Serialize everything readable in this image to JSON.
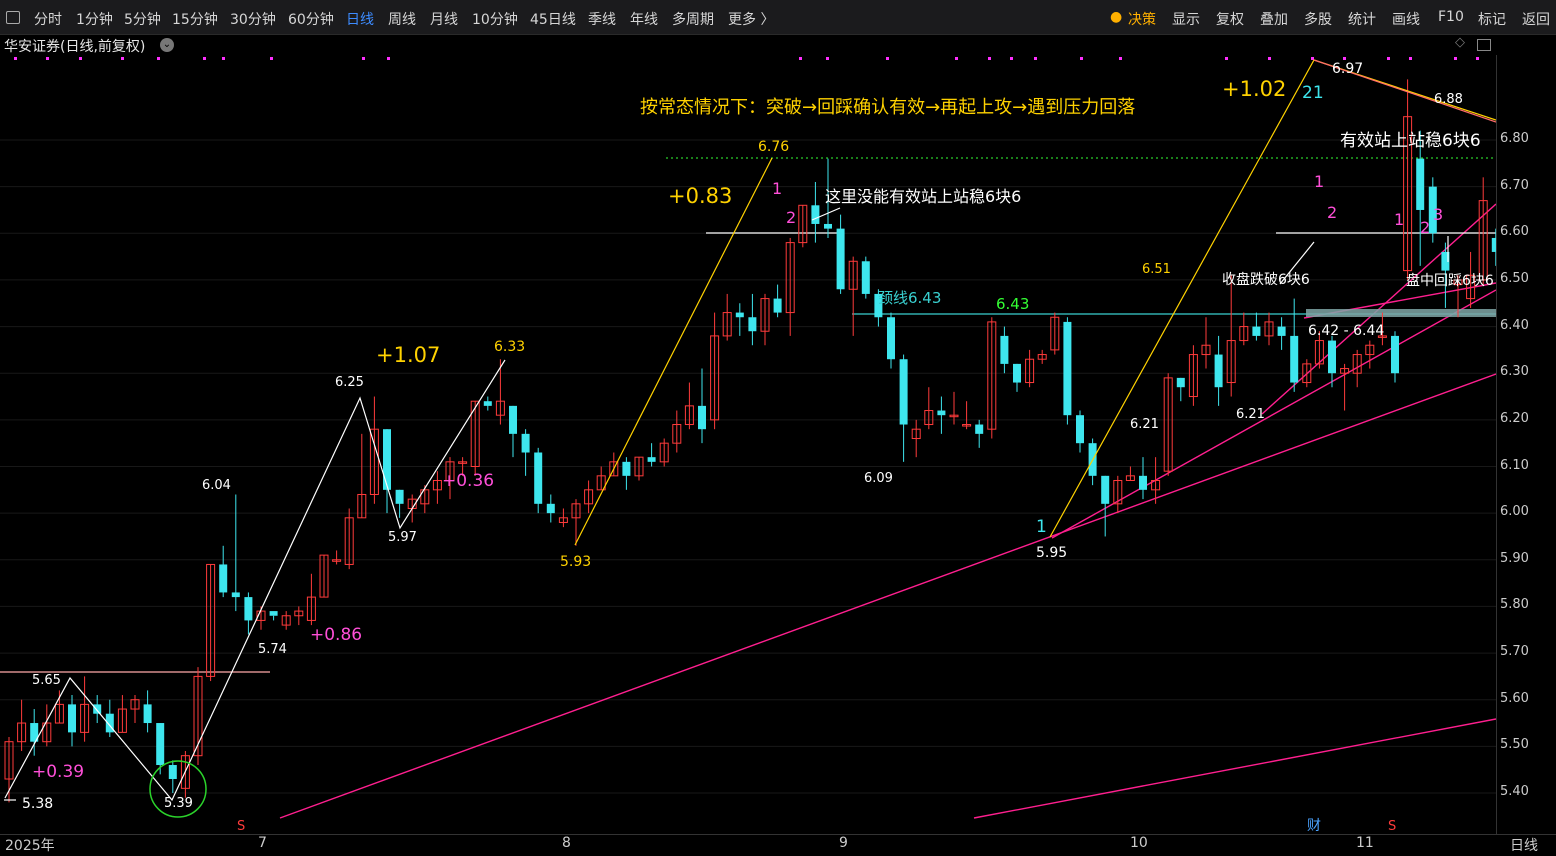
{
  "toolbar": {
    "periods": [
      "分时",
      "1分钟",
      "5分钟",
      "15分钟",
      "30分钟",
      "60分钟",
      "日线",
      "周线",
      "月线",
      "10分钟",
      "45日线",
      "季线",
      "年线",
      "多周期",
      "更多 〉"
    ],
    "active_period": "日线",
    "right": [
      "决策",
      "显示",
      "复权",
      "叠加",
      "多股",
      "统计",
      "画线",
      "F10",
      "标记",
      "返回"
    ]
  },
  "title": "华安证券(日线,前复权)",
  "period_label": "日线",
  "colors": {
    "up": "#ff3b3b",
    "down": "#3ee6ee",
    "annot_white": "#ffffff",
    "annot_yellow": "#ffd200",
    "annot_magenta": "#ff4fd8",
    "trend": "#ff1f8f",
    "neck": "#39d0d0"
  },
  "chart_data": {
    "type": "candlestick",
    "ylim": [
      5.35,
      6.95
    ],
    "y_ticks": [
      "5.40",
      "5.50",
      "5.60",
      "5.70",
      "5.80",
      "5.90",
      "6.00",
      "6.10",
      "6.20",
      "6.30",
      "6.40",
      "6.50",
      "6.60",
      "6.70",
      "6.80"
    ],
    "x_ticks": [
      "2025年",
      "7",
      "8",
      "9",
      "10",
      "11"
    ],
    "candles": [
      [
        5.43,
        5.51,
        5.38,
        5.52
      ],
      [
        5.51,
        5.55,
        5.49,
        5.6
      ],
      [
        5.55,
        5.51,
        5.48,
        5.58
      ],
      [
        5.51,
        5.55,
        5.5,
        5.59
      ],
      [
        5.55,
        5.59,
        5.55,
        5.62
      ],
      [
        5.59,
        5.53,
        5.5,
        5.61
      ],
      [
        5.53,
        5.59,
        5.51,
        5.65
      ],
      [
        5.59,
        5.57,
        5.55,
        5.61
      ],
      [
        5.57,
        5.53,
        5.52,
        5.6
      ],
      [
        5.53,
        5.58,
        5.53,
        5.61
      ],
      [
        5.58,
        5.6,
        5.55,
        5.61
      ],
      [
        5.59,
        5.55,
        5.53,
        5.62
      ],
      [
        5.55,
        5.46,
        5.44,
        5.55
      ],
      [
        5.46,
        5.43,
        5.4,
        5.47
      ],
      [
        5.41,
        5.48,
        5.39,
        5.49
      ],
      [
        5.48,
        5.65,
        5.46,
        5.67
      ],
      [
        5.65,
        5.89,
        5.64,
        5.89
      ],
      [
        5.89,
        5.83,
        5.82,
        5.93
      ],
      [
        5.83,
        5.82,
        5.79,
        6.04
      ],
      [
        5.82,
        5.77,
        5.74,
        5.83
      ],
      [
        5.77,
        5.79,
        5.75,
        5.8
      ],
      [
        5.79,
        5.78,
        5.77,
        5.78
      ],
      [
        5.76,
        5.78,
        5.75,
        5.79
      ],
      [
        5.78,
        5.79,
        5.76,
        5.8
      ],
      [
        5.77,
        5.82,
        5.76,
        5.87
      ],
      [
        5.82,
        5.91,
        5.82,
        5.91
      ],
      [
        5.9,
        5.9,
        5.89,
        5.92
      ],
      [
        5.89,
        5.99,
        5.88,
        6.01
      ],
      [
        5.99,
        6.04,
        5.99,
        6.17
      ],
      [
        6.04,
        6.18,
        6.02,
        6.25
      ],
      [
        6.18,
        6.05,
        6.0,
        6.18
      ],
      [
        6.05,
        6.02,
        5.99,
        6.05
      ],
      [
        6.01,
        6.03,
        5.98,
        6.04
      ],
      [
        6.02,
        6.05,
        6.0,
        6.06
      ],
      [
        6.05,
        6.07,
        6.02,
        6.09
      ],
      [
        6.07,
        6.11,
        6.03,
        6.12
      ],
      [
        6.11,
        6.11,
        6.08,
        6.12
      ],
      [
        6.1,
        6.24,
        6.08,
        6.24
      ],
      [
        6.24,
        6.23,
        6.22,
        6.25
      ],
      [
        6.21,
        6.24,
        6.19,
        6.33
      ],
      [
        6.23,
        6.17,
        6.12,
        6.23
      ],
      [
        6.17,
        6.13,
        6.08,
        6.18
      ],
      [
        6.13,
        6.02,
        6.0,
        6.14
      ],
      [
        6.02,
        6.0,
        5.98,
        6.04
      ],
      [
        5.98,
        5.99,
        5.97,
        6.01
      ],
      [
        5.99,
        6.02,
        5.93,
        6.03
      ],
      [
        6.02,
        6.05,
        6.0,
        6.07
      ],
      [
        6.05,
        6.08,
        6.05,
        6.1
      ],
      [
        6.08,
        6.11,
        6.08,
        6.13
      ],
      [
        6.11,
        6.08,
        6.05,
        6.12
      ],
      [
        6.08,
        6.12,
        6.07,
        6.12
      ],
      [
        6.12,
        6.11,
        6.1,
        6.15
      ],
      [
        6.11,
        6.15,
        6.1,
        6.16
      ],
      [
        6.15,
        6.19,
        6.13,
        6.22
      ],
      [
        6.19,
        6.23,
        6.18,
        6.28
      ],
      [
        6.23,
        6.18,
        6.15,
        6.31
      ],
      [
        6.2,
        6.38,
        6.18,
        6.43
      ],
      [
        6.38,
        6.43,
        6.37,
        6.47
      ],
      [
        6.43,
        6.42,
        6.38,
        6.45
      ],
      [
        6.42,
        6.39,
        6.36,
        6.47
      ],
      [
        6.39,
        6.46,
        6.36,
        6.47
      ],
      [
        6.46,
        6.43,
        6.42,
        6.49
      ],
      [
        6.43,
        6.58,
        6.38,
        6.59
      ],
      [
        6.58,
        6.66,
        6.57,
        6.66
      ],
      [
        6.66,
        6.62,
        6.58,
        6.71
      ],
      [
        6.62,
        6.61,
        6.59,
        6.76
      ],
      [
        6.61,
        6.48,
        6.47,
        6.64
      ],
      [
        6.48,
        6.54,
        6.38,
        6.55
      ],
      [
        6.54,
        6.47,
        6.46,
        6.55
      ],
      [
        6.47,
        6.42,
        6.4,
        6.48
      ],
      [
        6.42,
        6.33,
        6.31,
        6.43
      ],
      [
        6.33,
        6.19,
        6.11,
        6.34
      ],
      [
        6.16,
        6.18,
        6.12,
        6.2
      ],
      [
        6.19,
        6.22,
        6.18,
        6.27
      ],
      [
        6.22,
        6.21,
        6.17,
        6.25
      ],
      [
        6.21,
        6.21,
        6.19,
        6.26
      ],
      [
        6.19,
        6.19,
        6.18,
        6.24
      ],
      [
        6.19,
        6.17,
        6.14,
        6.2
      ],
      [
        6.18,
        6.41,
        6.16,
        6.42
      ],
      [
        6.38,
        6.32,
        6.3,
        6.4
      ],
      [
        6.32,
        6.28,
        6.26,
        6.32
      ],
      [
        6.28,
        6.33,
        6.27,
        6.35
      ],
      [
        6.33,
        6.34,
        6.32,
        6.35
      ],
      [
        6.35,
        6.42,
        6.34,
        6.43
      ],
      [
        6.41,
        6.21,
        6.19,
        6.42
      ],
      [
        6.21,
        6.15,
        6.13,
        6.22
      ],
      [
        6.15,
        6.08,
        6.06,
        6.16
      ],
      [
        6.08,
        6.02,
        5.95,
        6.08
      ],
      [
        6.02,
        6.07,
        6.0,
        6.08
      ],
      [
        6.07,
        6.08,
        6.07,
        6.1
      ],
      [
        6.08,
        6.05,
        6.03,
        6.12
      ],
      [
        6.05,
        6.07,
        6.02,
        6.12
      ],
      [
        6.09,
        6.29,
        6.08,
        6.3
      ],
      [
        6.29,
        6.27,
        6.24,
        6.29
      ],
      [
        6.25,
        6.34,
        6.23,
        6.36
      ],
      [
        6.34,
        6.36,
        6.31,
        6.42
      ],
      [
        6.34,
        6.27,
        6.23,
        6.38
      ],
      [
        6.28,
        6.37,
        6.25,
        6.51
      ],
      [
        6.37,
        6.4,
        6.36,
        6.43
      ],
      [
        6.4,
        6.38,
        6.37,
        6.43
      ],
      [
        6.38,
        6.41,
        6.36,
        6.43
      ],
      [
        6.4,
        6.38,
        6.35,
        6.42
      ],
      [
        6.38,
        6.28,
        6.26,
        6.46
      ],
      [
        6.28,
        6.32,
        6.27,
        6.33
      ],
      [
        6.32,
        6.37,
        6.31,
        6.39
      ],
      [
        6.37,
        6.3,
        6.27,
        6.38
      ],
      [
        6.3,
        6.31,
        6.22,
        6.32
      ],
      [
        6.3,
        6.34,
        6.27,
        6.35
      ],
      [
        6.34,
        6.36,
        6.31,
        6.37
      ],
      [
        6.38,
        6.38,
        6.36,
        6.43
      ],
      [
        6.38,
        6.3,
        6.28,
        6.39
      ],
      [
        6.52,
        6.85,
        6.5,
        6.93
      ],
      [
        6.76,
        6.65,
        6.53,
        6.82
      ],
      [
        6.7,
        6.6,
        6.58,
        6.72
      ],
      [
        6.56,
        6.52,
        6.44,
        6.58
      ],
      [
        6.49,
        6.5,
        6.42,
        6.51
      ],
      [
        6.46,
        6.51,
        6.44,
        6.56
      ],
      [
        6.5,
        6.67,
        6.49,
        6.72
      ],
      [
        6.59,
        6.56,
        6.53,
        6.61
      ],
      [
        6.55,
        6.69,
        6.53,
        6.76
      ],
      [
        6.67,
        6.71,
        6.6,
        6.88
      ],
      [
        6.69,
        6.67,
        6.64,
        6.74
      ]
    ]
  },
  "annotations": {
    "main_note": "按常态情况下：突破→回踩确认有效→再起上攻→遇到压力回落",
    "fail_note": "这里没能有效站上站稳6块6",
    "hold_note": "有效站上站稳6块6",
    "break_note": "收盘跌破6块6",
    "intraday_note": "盘中回踩6块6",
    "neck_label": "颈线6.43",
    "zone_label": "6.42 - 6.44",
    "neck_price": "6.43",
    "gains": [
      "+0.39",
      "+0.86",
      "+1.07",
      "+0.36",
      "+0.83",
      "+1.02"
    ],
    "prices": {
      "p538": "5.38",
      "p565": "5.65",
      "p539": "5.39",
      "p604": "6.04",
      "p574": "5.74",
      "p625": "6.25",
      "p597": "5.97",
      "p633": "6.33",
      "p593": "5.93",
      "p676": "6.76",
      "p609": "6.09",
      "p595": "5.95",
      "p621a": "6.21",
      "p651": "6.51",
      "p621b": "6.21",
      "p697": "6.97",
      "p688": "6.88"
    },
    "counts": [
      "1",
      "2",
      "1",
      "21",
      "1",
      "2",
      "1",
      "2",
      "3"
    ],
    "markers": {
      "cai": "财",
      "s": "S"
    }
  }
}
